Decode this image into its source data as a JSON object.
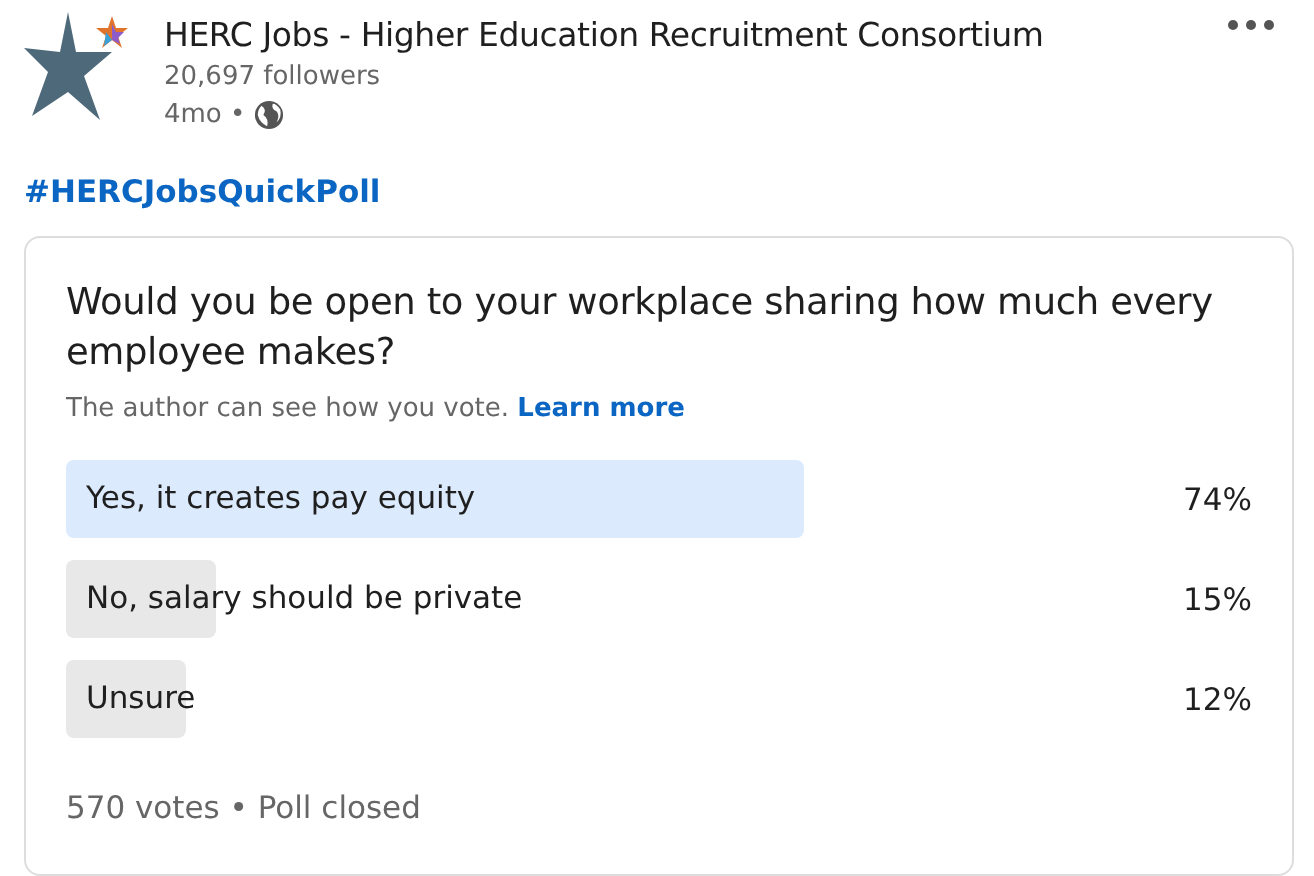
{
  "post": {
    "author": "HERC Jobs - Higher Education Recruitment Consortium",
    "followers": "20,697 followers",
    "age": "4mo •",
    "hashtag": "#HERCJobsQuickPoll"
  },
  "poll": {
    "question": "Would you be open to your workplace sharing how much every employee makes?",
    "note": "The author can see how you vote.",
    "note_link": "Learn more",
    "options": [
      {
        "label": "Yes, it creates pay equity",
        "percent": "74%",
        "selected": true
      },
      {
        "label": "No, salary should be private",
        "percent": "15%",
        "selected": false
      },
      {
        "label": "Unsure",
        "percent": "12%",
        "selected": false
      }
    ],
    "footer": "570 votes • Poll closed"
  }
}
